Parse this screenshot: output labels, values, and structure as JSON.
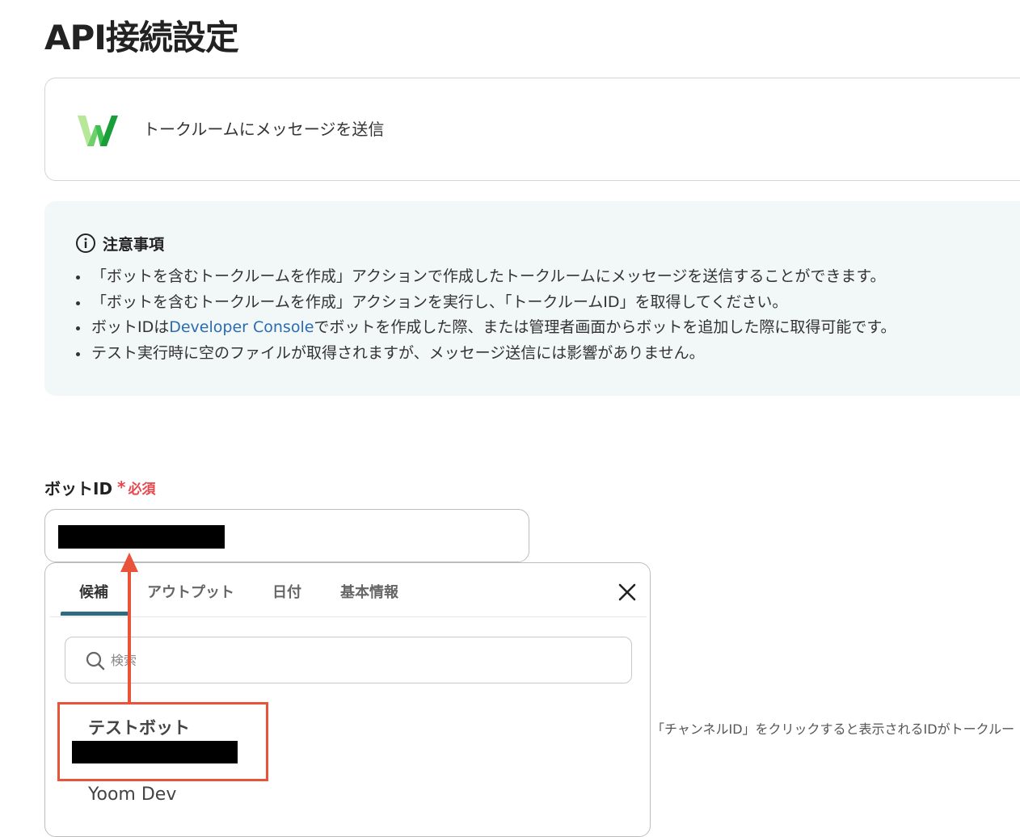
{
  "page": {
    "title": "API接続設定"
  },
  "action": {
    "title": "トークルームにメッセージを送信",
    "logo_icon": "line-works-logo"
  },
  "notice": {
    "title": "注意事項",
    "items": [
      "「ボットを含むトークルームを作成」アクションで作成したトークルームにメッセージを送信することができます。",
      "「ボットを含むトークルームを作成」アクションを実行し、「トークルームID」を取得してください。",
      {
        "prefix": "ボットIDは",
        "link": "Developer Console",
        "suffix": "でボットを作成した際、または管理者画面からボットを追加した際に取得可能です。"
      },
      "テスト実行時に空のファイルが取得されますが、メッセージ送信には影響がありません。"
    ]
  },
  "bot_id_field": {
    "label": "ボットID",
    "required_mark": "*",
    "required_text": "必須"
  },
  "dropdown": {
    "tabs": [
      {
        "label": "候補",
        "active": true
      },
      {
        "label": "アウトプット",
        "active": false
      },
      {
        "label": "日付",
        "active": false
      },
      {
        "label": "基本情報",
        "active": false
      }
    ],
    "search": {
      "value": "",
      "placeholder": "検索"
    },
    "candidates": [
      {
        "name": "テストボット"
      },
      {
        "name": "Yoom Dev"
      }
    ]
  },
  "help_text": "「チャンネルID」をクリックすると表示されるIDがトークルー",
  "colors": {
    "accent_tab": "#2f6a80",
    "required": "#e5484d",
    "link": "#2b6cb0",
    "annotation": "#e8533a",
    "notice_bg": "#f2f7f8"
  }
}
